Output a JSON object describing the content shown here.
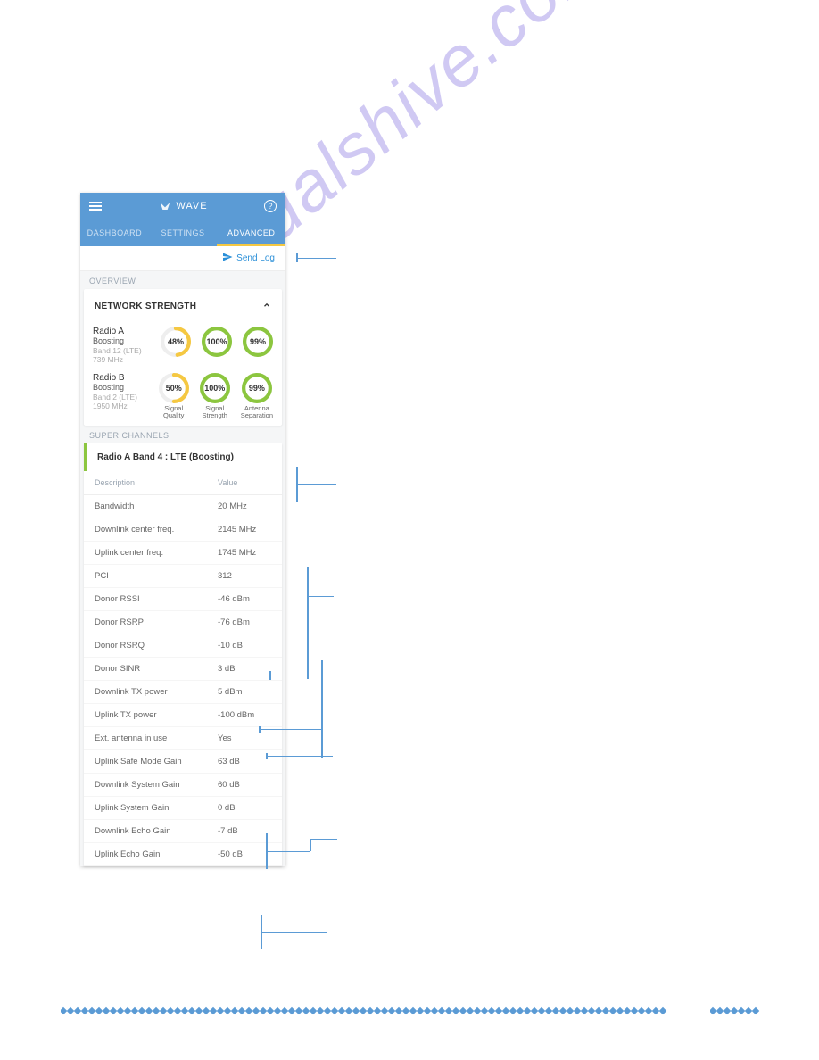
{
  "watermark": "manualshive.com",
  "app": {
    "title": "WAVE",
    "tabs": [
      "DASHBOARD",
      "SETTINGS",
      "ADVANCED"
    ],
    "active_tab": 2,
    "send_log": "Send Log"
  },
  "overview": {
    "label": "OVERVIEW",
    "card_title": "NETWORK STRENGTH",
    "radios": [
      {
        "name": "Radio A",
        "status": "Boosting",
        "band": "Band 12 (LTE)",
        "freq": "739 MHz",
        "gauges": [
          {
            "pct": 48,
            "text": "48%",
            "color": "#f5c842"
          },
          {
            "pct": 100,
            "text": "100%",
            "color": "#8cc63f"
          },
          {
            "pct": 99,
            "text": "99%",
            "color": "#8cc63f"
          }
        ]
      },
      {
        "name": "Radio B",
        "status": "Boosting",
        "band": "Band 2 (LTE)",
        "freq": "1950 MHz",
        "gauges": [
          {
            "pct": 50,
            "text": "50%",
            "color": "#f5c842"
          },
          {
            "pct": 100,
            "text": "100%",
            "color": "#8cc63f"
          },
          {
            "pct": 99,
            "text": "99%",
            "color": "#8cc63f"
          }
        ]
      }
    ],
    "gauge_labels": [
      "Signal\nQuality",
      "Signal\nStrength",
      "Antenna\nSeparation"
    ]
  },
  "super_channels": {
    "label": "SUPER CHANNELS",
    "header": "Radio A Band 4 : LTE (Boosting)",
    "col_desc": "Description",
    "col_val": "Value",
    "rows": [
      {
        "desc": "Bandwidth",
        "val": "20 MHz"
      },
      {
        "desc": "Downlink center freq.",
        "val": "2145 MHz"
      },
      {
        "desc": "Uplink center freq.",
        "val": "1745 MHz"
      },
      {
        "desc": "PCI",
        "val": "312"
      },
      {
        "desc": "Donor RSSI",
        "val": "-46 dBm"
      },
      {
        "desc": "Donor RSRP",
        "val": "-76 dBm"
      },
      {
        "desc": "Donor RSRQ",
        "val": "-10 dB"
      },
      {
        "desc": "Donor SINR",
        "val": "3 dB"
      },
      {
        "desc": "Downlink TX power",
        "val": "5 dBm"
      },
      {
        "desc": "Uplink TX power",
        "val": "-100 dBm"
      },
      {
        "desc": "Ext. antenna in use",
        "val": "Yes"
      },
      {
        "desc": "Uplink Safe Mode Gain",
        "val": "63 dB"
      },
      {
        "desc": "Downlink System Gain",
        "val": "60 dB"
      },
      {
        "desc": "Uplink System Gain",
        "val": "0 dB"
      },
      {
        "desc": "Downlink Echo Gain",
        "val": "-7 dB"
      },
      {
        "desc": "Uplink Echo Gain",
        "val": "-50 dB"
      }
    ]
  }
}
